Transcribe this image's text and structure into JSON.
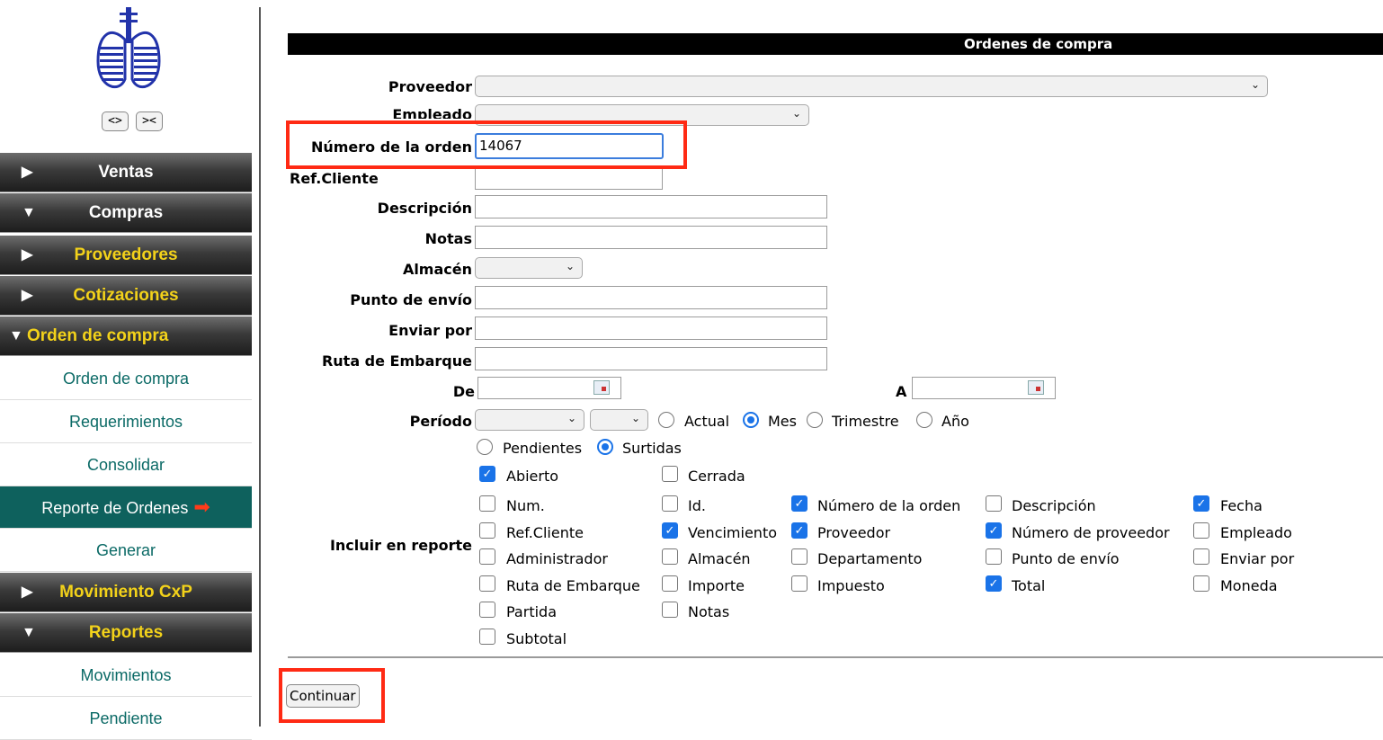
{
  "sidebar": {
    "nav_buttons": [
      "<>",
      "><"
    ],
    "items": [
      {
        "label": "Ventas",
        "arrow": "▶",
        "color": "white"
      },
      {
        "label": "Compras",
        "arrow": "▼",
        "color": "white"
      },
      {
        "label": "Proveedores",
        "arrow": "▶",
        "color": "yellow"
      },
      {
        "label": "Cotizaciones",
        "arrow": "▶",
        "color": "yellow"
      },
      {
        "label": "Orden de compra",
        "arrow": "▼",
        "color": "yellow"
      }
    ],
    "subitems": [
      "Orden de compra",
      "Requerimientos",
      "Consolidar",
      "Reporte de Ordenes",
      "Generar"
    ],
    "active_subitem": "Reporte de Ordenes",
    "items2": [
      {
        "label": "Movimiento CxP",
        "arrow": "▶",
        "color": "yellow"
      },
      {
        "label": "Reportes",
        "arrow": "▼",
        "color": "yellow"
      }
    ],
    "subitems2": [
      "Movimientos",
      "Pendiente"
    ]
  },
  "title": "Ordenes de compra",
  "form": {
    "proveedor_label": "Proveedor",
    "empleado_label": "Empleado",
    "numero_orden_label": "Número de la orden",
    "numero_orden_value": "14067",
    "ref_cliente_label": "Ref.Cliente",
    "descripcion_label": "Descripción",
    "notas_label": "Notas",
    "almacen_label": "Almacén",
    "punto_envio_label": "Punto de envío",
    "enviar_por_label": "Enviar por",
    "ruta_label": "Ruta de Embarque",
    "de_label": "De",
    "a_label": "A",
    "periodo_label": "Período",
    "periodo_options": [
      {
        "label": "Actual",
        "selected": false
      },
      {
        "label": "Mes",
        "selected": true
      },
      {
        "label": "Trimestre",
        "selected": false
      },
      {
        "label": "Año",
        "selected": false
      }
    ],
    "estado_options": [
      {
        "label": "Pendientes",
        "selected": false
      },
      {
        "label": "Surtidas",
        "selected": true
      }
    ],
    "abierto": {
      "label": "Abierto",
      "checked": true
    },
    "cerrada": {
      "label": "Cerrada",
      "checked": false
    },
    "incluir_label": "Incluir en reporte",
    "report_columns": [
      {
        "label": "Num.",
        "checked": false
      },
      {
        "label": "Id.",
        "checked": false
      },
      {
        "label": "Número de la orden",
        "checked": true
      },
      {
        "label": "Descripción",
        "checked": false
      },
      {
        "label": "Fecha",
        "checked": true
      },
      {
        "label": "Ref.Cliente",
        "checked": false
      },
      {
        "label": "Vencimiento",
        "checked": true
      },
      {
        "label": "Proveedor",
        "checked": true
      },
      {
        "label": "Número de proveedor",
        "checked": true
      },
      {
        "label": "Empleado",
        "checked": false
      },
      {
        "label": "Administrador",
        "checked": false
      },
      {
        "label": "Almacén",
        "checked": false
      },
      {
        "label": "Departamento",
        "checked": false
      },
      {
        "label": "Punto de envío",
        "checked": false
      },
      {
        "label": "Enviar por",
        "checked": false
      },
      {
        "label": "Ruta de Embarque",
        "checked": false
      },
      {
        "label": "Importe",
        "checked": false
      },
      {
        "label": "Impuesto",
        "checked": false
      },
      {
        "label": "Total",
        "checked": true
      },
      {
        "label": "Moneda",
        "checked": false
      },
      {
        "label": "Partida",
        "checked": false
      },
      {
        "label": "Notas",
        "checked": false
      },
      {
        "label": "Subtotal",
        "checked": false
      }
    ],
    "continuar_label": "Continuar"
  },
  "colors": {
    "accent": "#1a73e8",
    "highlight_box": "#ff2a14",
    "menu_yellow": "#f3d21a",
    "sub_teal": "#0b6a66",
    "active_bg": "#0e615d"
  }
}
